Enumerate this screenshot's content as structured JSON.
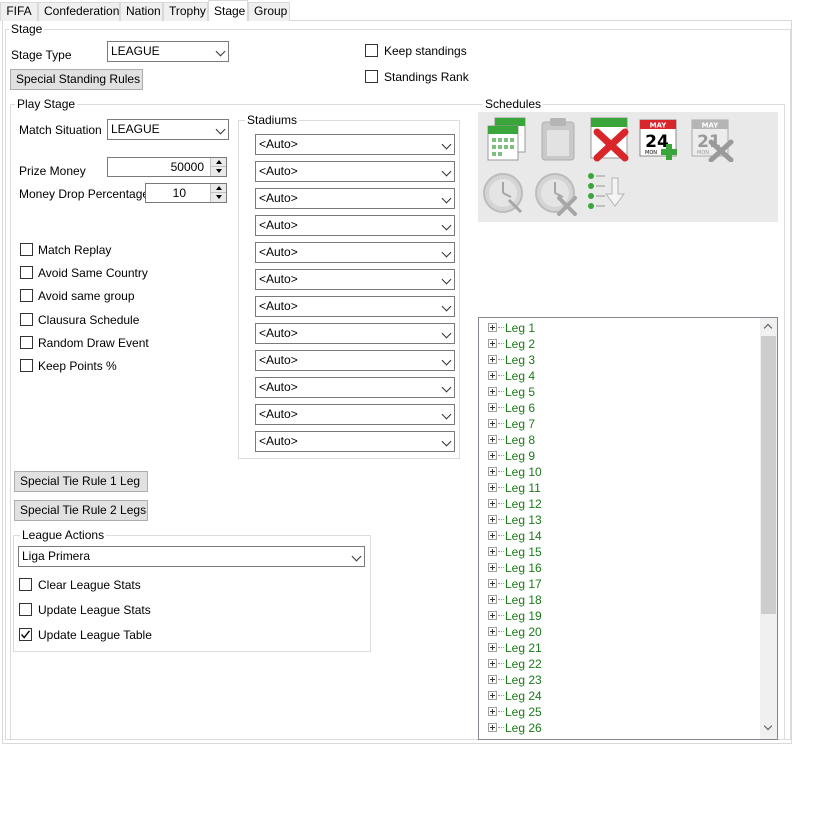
{
  "tabs": [
    "FIFA",
    "Confederation",
    "Nation",
    "Trophy",
    "Stage",
    "Group"
  ],
  "active_tab": "Stage",
  "stage_group": {
    "title": "Stage",
    "stage_type_label": "Stage Type",
    "stage_type_value": "LEAGUE",
    "special_standing_rules_button": "Special Standing Rules",
    "keep_standings_label": "Keep standings",
    "keep_standings_checked": false,
    "standings_rank_label": "Standings Rank",
    "standings_rank_checked": false
  },
  "play_stage": {
    "title": "Play Stage",
    "match_situation_label": "Match Situation",
    "match_situation_value": "LEAGUE",
    "prize_money_label": "Prize Money",
    "prize_money_value": "50000",
    "money_drop_label": "Money Drop Percentage",
    "money_drop_value": "10",
    "checkboxes": [
      {
        "label": "Match Replay",
        "checked": false
      },
      {
        "label": "Avoid Same Country",
        "checked": false
      },
      {
        "label": "Avoid same group",
        "checked": false
      },
      {
        "label": "Clausura Schedule",
        "checked": false
      },
      {
        "label": "Random Draw Event",
        "checked": false
      },
      {
        "label": "Keep Points %",
        "checked": false
      }
    ],
    "stadiums_title": "Stadiums",
    "stadiums": [
      "<Auto>",
      "<Auto>",
      "<Auto>",
      "<Auto>",
      "<Auto>",
      "<Auto>",
      "<Auto>",
      "<Auto>",
      "<Auto>",
      "<Auto>",
      "<Auto>",
      "<Auto>"
    ],
    "tie_rule_1_button": "Special Tie Rule 1 Leg",
    "tie_rule_2_button": "Special Tie Rule 2 Legs"
  },
  "league_actions": {
    "title": "League Actions",
    "league_value": "Liga Primera",
    "checkboxes": [
      {
        "label": "Clear League Stats",
        "checked": false
      },
      {
        "label": "Update League Stats",
        "checked": false
      },
      {
        "label": "Update League Table",
        "checked": true
      }
    ]
  },
  "schedules": {
    "title": "Schedules",
    "calendar_month": "MAY",
    "calendar_day": "24",
    "calendar_day_disabled": "21",
    "calendar_weekday": "MON",
    "legs": [
      "Leg 1",
      "Leg 2",
      "Leg 3",
      "Leg 4",
      "Leg 5",
      "Leg 6",
      "Leg 7",
      "Leg 8",
      "Leg 9",
      "Leg 10",
      "Leg 11",
      "Leg 12",
      "Leg 13",
      "Leg 14",
      "Leg 15",
      "Leg 16",
      "Leg 17",
      "Leg 18",
      "Leg 19",
      "Leg 20",
      "Leg 21",
      "Leg 22",
      "Leg 23",
      "Leg 24",
      "Leg 25",
      "Leg 26"
    ]
  },
  "colors": {
    "leg_text": "#1a7a1a",
    "toolbar_bg": "#e9e9e9",
    "green_header": "#3aa53a",
    "red_x": "#d9262b"
  }
}
